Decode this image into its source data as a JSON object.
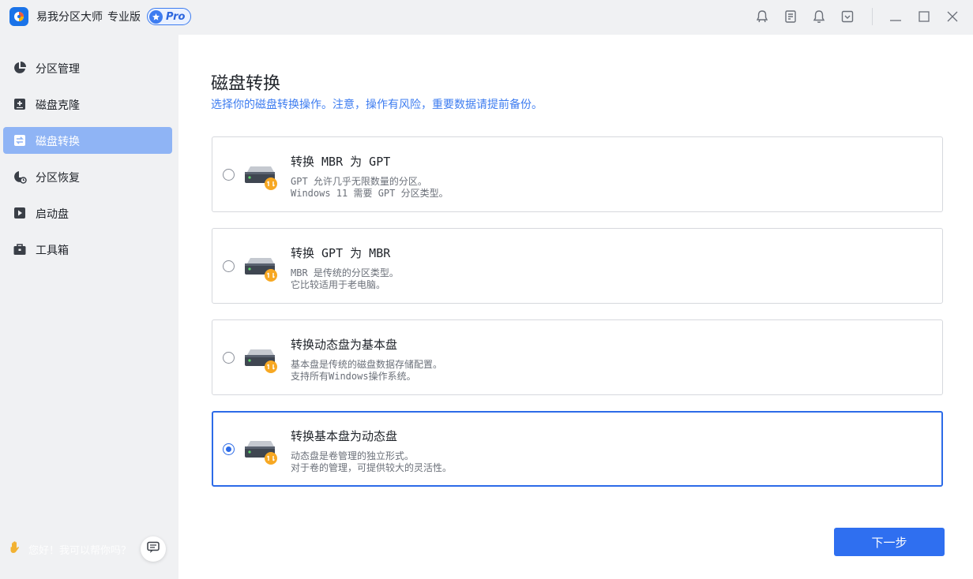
{
  "app": {
    "title": "易我分区大师",
    "edition": "专业版",
    "badge": "Pro",
    "accent_color": "#2f6ff0"
  },
  "titlebar_icons": [
    "support-icon",
    "feedback-icon",
    "notification-icon",
    "download-icon",
    "minimize-icon",
    "maximize-icon",
    "close-icon"
  ],
  "sidebar": {
    "items": [
      {
        "label": "分区管理",
        "icon": "pie-chart-icon",
        "active": false
      },
      {
        "label": "磁盘克隆",
        "icon": "clone-icon",
        "active": false
      },
      {
        "label": "磁盘转换",
        "icon": "convert-icon",
        "active": true
      },
      {
        "label": "分区恢复",
        "icon": "recovery-icon",
        "active": false
      },
      {
        "label": "启动盘",
        "icon": "boot-disk-icon",
        "active": false
      },
      {
        "label": "工具箱",
        "icon": "toolbox-icon",
        "active": false
      }
    ],
    "chat_hint": "您好！我可以帮你吗？"
  },
  "main": {
    "title": "磁盘转换",
    "subtitle": "选择你的磁盘转换操作。注意，操作有风险，重要数据请提前备份。",
    "options": [
      {
        "title": "转换 MBR 为 GPT",
        "desc_line1": "GPT 允许几乎无限数量的分区。",
        "desc_line2": "Windows 11 需要 GPT 分区类型。",
        "selected": false
      },
      {
        "title": "转换 GPT 为 MBR",
        "desc_line1": "MBR 是传统的分区类型。",
        "desc_line2": "它比较适用于老电脑。",
        "selected": false
      },
      {
        "title": "转换动态盘为基本盘",
        "desc_line1": "基本盘是传统的磁盘数据存储配置。",
        "desc_line2": "支持所有Windows操作系统。",
        "selected": false
      },
      {
        "title": "转换基本盘为动态盘",
        "desc_line1": "动态盘是卷管理的独立形式。",
        "desc_line2": "对于卷的管理，可提供较大的灵活性。",
        "selected": true
      }
    ],
    "next_button": "下一步"
  }
}
